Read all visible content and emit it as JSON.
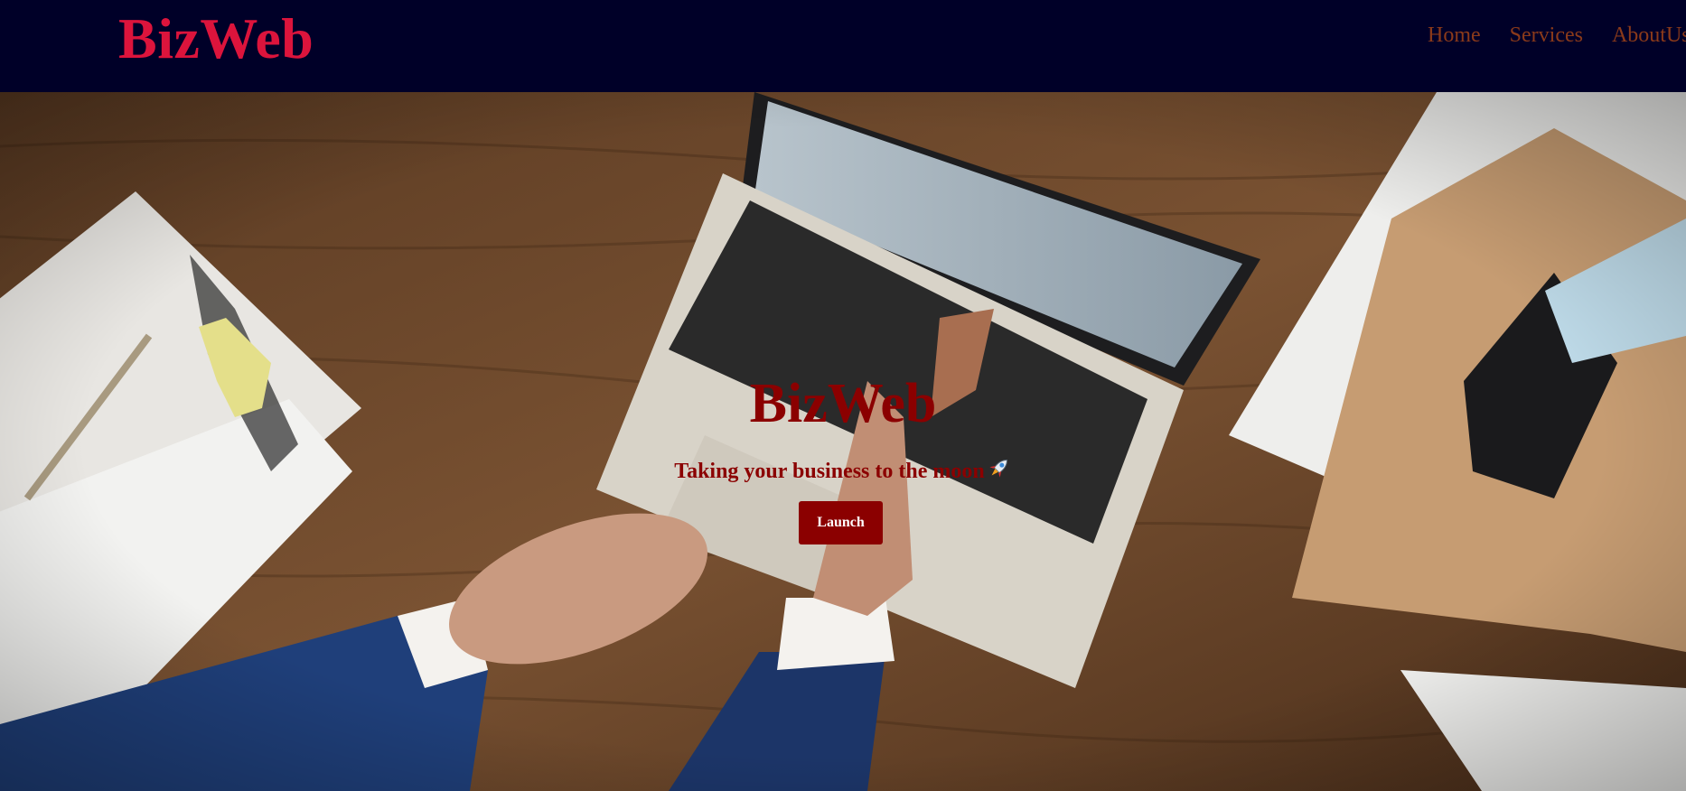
{
  "navbar": {
    "brand": "BizWeb",
    "links": [
      {
        "label": "Home"
      },
      {
        "label": "Services"
      },
      {
        "label": "AboutUs"
      }
    ]
  },
  "hero": {
    "title": "BizWeb",
    "tagline": "Taking your business to the moon",
    "button_label": "Launch",
    "tagline_icon": "rocket-icon"
  },
  "colors": {
    "navbar_bg": "#000028",
    "brand": "#dc143c",
    "nav_link": "#8b3a1a",
    "hero_text": "#8b0000",
    "button_bg": "#8b0000",
    "button_text": "#ffffff"
  }
}
